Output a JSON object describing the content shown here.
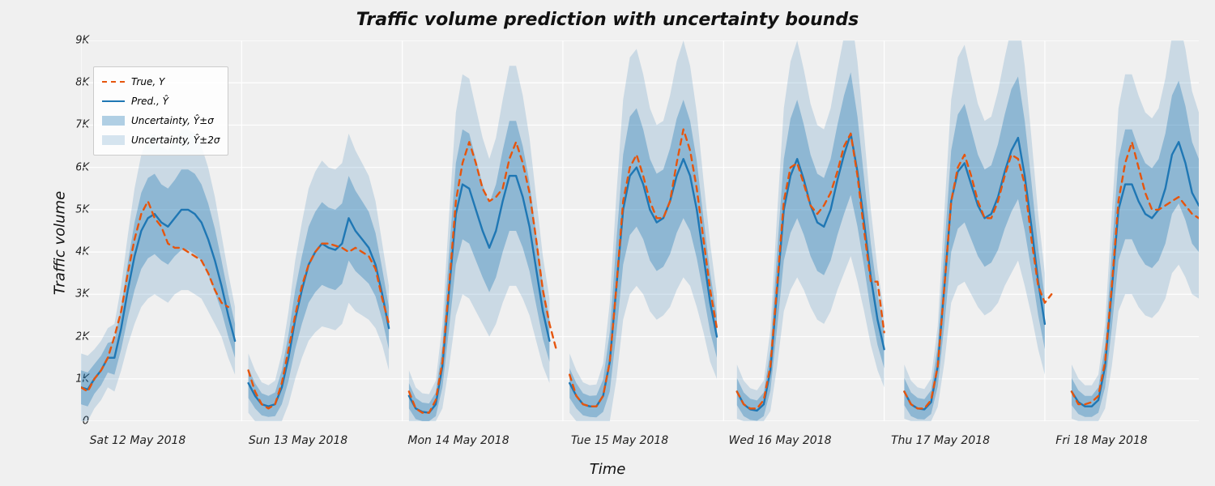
{
  "chart_data": {
    "type": "line",
    "title": "Traffic volume prediction with uncertainty bounds",
    "xlabel": "Time",
    "ylabel": "Traffic volume",
    "ylim": [
      0,
      9000
    ],
    "y_ticks": [
      0,
      1000,
      2000,
      3000,
      4000,
      5000,
      6000,
      7000,
      8000,
      9000
    ],
    "y_tick_labels": [
      "0",
      "1K",
      "2K",
      "3K",
      "4K",
      "5K",
      "6K",
      "7K",
      "8K",
      "9K"
    ],
    "x_tick_labels": [
      "Sat 12 May 2018",
      "Sun 13 May 2018",
      "Mon 14 May 2018",
      "Tue 15 May 2018",
      "Wed 16 May 2018",
      "Thu 17 May 2018",
      "Fri 18 May 2018"
    ],
    "x_tick_positions_hours": [
      0,
      24,
      48,
      72,
      96,
      120,
      144
    ],
    "legend": {
      "true": "True, Y",
      "pred": "Pred., Ŷ",
      "sigma1": "Uncertainty, Ŷ±σ",
      "sigma2": "Uncertainty, Ŷ±2σ"
    },
    "colors": {
      "true_line": "#e6550d",
      "pred_line": "#1f77b4",
      "band1": "rgba(31,119,180,0.35)",
      "band2": "rgba(31,119,180,0.18)",
      "background": "#f0f0f0",
      "grid": "#ffffff"
    },
    "series_note": "Hourly values over 7 days (168 points). 'true' and 'pred' are traffic volume; sigma is prediction std used for ±σ and ±2σ bands. Some hours have null (gaps in plotted lines).",
    "series": {
      "hour_index": [
        0,
        1,
        2,
        3,
        4,
        5,
        6,
        7,
        8,
        9,
        10,
        11,
        12,
        13,
        14,
        15,
        16,
        17,
        18,
        19,
        20,
        21,
        22,
        23,
        24,
        25,
        26,
        27,
        28,
        29,
        30,
        31,
        32,
        33,
        34,
        35,
        36,
        37,
        38,
        39,
        40,
        41,
        42,
        43,
        44,
        45,
        46,
        47,
        48,
        49,
        50,
        51,
        52,
        53,
        54,
        55,
        56,
        57,
        58,
        59,
        60,
        61,
        62,
        63,
        64,
        65,
        66,
        67,
        68,
        69,
        70,
        71,
        72,
        73,
        74,
        75,
        76,
        77,
        78,
        79,
        80,
        81,
        82,
        83,
        84,
        85,
        86,
        87,
        88,
        89,
        90,
        91,
        92,
        93,
        94,
        95,
        96,
        97,
        98,
        99,
        100,
        101,
        102,
        103,
        104,
        105,
        106,
        107,
        108,
        109,
        110,
        111,
        112,
        113,
        114,
        115,
        116,
        117,
        118,
        119,
        120,
        121,
        122,
        123,
        124,
        125,
        126,
        127,
        128,
        129,
        130,
        131,
        132,
        133,
        134,
        135,
        136,
        137,
        138,
        139,
        140,
        141,
        142,
        143,
        144,
        145,
        146,
        147,
        148,
        149,
        150,
        151,
        152,
        153,
        154,
        155,
        156,
        157,
        158,
        159,
        160,
        161,
        162,
        163,
        164,
        165,
        166,
        167
      ],
      "true": [
        800,
        700,
        1000,
        1200,
        1500,
        2000,
        2600,
        3500,
        4300,
        4900,
        5200,
        4800,
        4600,
        4200,
        4100,
        4100,
        4000,
        3900,
        3800,
        3500,
        3100,
        2800,
        2700,
        null,
        null,
        1200,
        700,
        400,
        300,
        400,
        900,
        1700,
        2500,
        3200,
        3700,
        4000,
        4200,
        4200,
        4150,
        4100,
        4000,
        4100,
        4000,
        3900,
        3600,
        2900,
        2300,
        null,
        null,
        700,
        300,
        200,
        200,
        500,
        1400,
        3200,
        5200,
        6100,
        6600,
        6100,
        5500,
        5200,
        5300,
        5500,
        6200,
        6600,
        6100,
        5400,
        4300,
        3100,
        2300,
        1700,
        null,
        1100,
        600,
        400,
        350,
        350,
        600,
        1400,
        3200,
        5200,
        6000,
        6300,
        5800,
        5200,
        4800,
        4800,
        5200,
        6100,
        6900,
        6400,
        5500,
        4300,
        3100,
        2200,
        null,
        null,
        700,
        400,
        300,
        300,
        500,
        1300,
        3200,
        5200,
        6000,
        6100,
        5600,
        5100,
        4900,
        5100,
        5400,
        5900,
        6500,
        6800,
        5800,
        4500,
        3300,
        3300,
        2100,
        null,
        null,
        700,
        400,
        300,
        300,
        500,
        1300,
        3200,
        5200,
        6000,
        6300,
        5800,
        5200,
        4800,
        4800,
        5200,
        5800,
        6300,
        6200,
        5600,
        4300,
        3200,
        2800,
        3000,
        null,
        null,
        700,
        400,
        400,
        450,
        600,
        1400,
        3200,
        5200,
        6100,
        6600,
        6000,
        5400,
        5000,
        5000,
        5100,
        5200,
        5300,
        5100,
        4900,
        4800,
        null,
        null,
        null
      ],
      "pred": [
        800,
        750,
        1000,
        1200,
        1500,
        1500,
        2200,
        3100,
        3900,
        4500,
        4800,
        4900,
        4700,
        4600,
        4800,
        5000,
        5000,
        4900,
        4700,
        4300,
        3800,
        3200,
        2500,
        1900,
        null,
        900,
        600,
        400,
        350,
        400,
        800,
        1500,
        2400,
        3100,
        3700,
        4000,
        4200,
        4100,
        4050,
        4200,
        4800,
        4500,
        4300,
        4100,
        3700,
        3000,
        2200,
        null,
        null,
        600,
        300,
        220,
        200,
        400,
        1300,
        3100,
        4900,
        5600,
        5500,
        5000,
        4500,
        4100,
        4500,
        5200,
        5800,
        5800,
        5300,
        4600,
        3600,
        2600,
        1900,
        null,
        null,
        900,
        600,
        400,
        350,
        350,
        600,
        1400,
        3200,
        5000,
        5800,
        6000,
        5600,
        5000,
        4700,
        4800,
        5200,
        5800,
        6200,
        5800,
        5000,
        3900,
        2800,
        2000,
        null,
        null,
        700,
        400,
        280,
        250,
        400,
        1200,
        3100,
        5000,
        5800,
        6200,
        5700,
        5100,
        4700,
        4600,
        5000,
        5700,
        6300,
        6800,
        5900,
        4700,
        3400,
        2400,
        1700,
        null,
        null,
        700,
        400,
        300,
        280,
        450,
        1300,
        3200,
        5200,
        5900,
        6100,
        5600,
        5100,
        4800,
        4900,
        5300,
        5900,
        6400,
        6700,
        5800,
        4600,
        3300,
        2300,
        null,
        null,
        null,
        700,
        450,
        350,
        350,
        500,
        1300,
        3100,
        5000,
        5600,
        5600,
        5200,
        4900,
        4800,
        5000,
        5500,
        6300,
        6600,
        6100,
        5400,
        5100,
        5000,
        5100,
        null
      ],
      "sigma": [
        400,
        400,
        350,
        350,
        350,
        400,
        500,
        650,
        800,
        900,
        950,
        950,
        900,
        900,
        900,
        950,
        950,
        950,
        900,
        850,
        750,
        600,
        500,
        400,
        0,
        350,
        300,
        260,
        250,
        280,
        400,
        550,
        700,
        800,
        900,
        950,
        980,
        950,
        950,
        950,
        1000,
        950,
        900,
        850,
        750,
        600,
        500,
        0,
        0,
        300,
        250,
        220,
        220,
        280,
        500,
        900,
        1200,
        1300,
        1300,
        1200,
        1100,
        1050,
        1100,
        1200,
        1300,
        1300,
        1200,
        1050,
        850,
        650,
        500,
        0,
        0,
        350,
        300,
        260,
        250,
        260,
        380,
        700,
        1100,
        1300,
        1400,
        1400,
        1300,
        1200,
        1150,
        1150,
        1250,
        1350,
        1400,
        1300,
        1150,
        900,
        700,
        500,
        0,
        0,
        320,
        280,
        250,
        240,
        280,
        480,
        900,
        1200,
        1350,
        1400,
        1300,
        1200,
        1150,
        1150,
        1200,
        1300,
        1400,
        1450,
        1300,
        1050,
        800,
        600,
        450,
        0,
        0,
        320,
        280,
        250,
        240,
        280,
        480,
        900,
        1200,
        1350,
        1400,
        1300,
        1200,
        1150,
        1150,
        1250,
        1350,
        1450,
        1450,
        1300,
        1050,
        800,
        600,
        0,
        0,
        0,
        320,
        280,
        250,
        250,
        300,
        500,
        900,
        1200,
        1300,
        1300,
        1250,
        1200,
        1180,
        1200,
        1300,
        1400,
        1450,
        1350,
        1200,
        1100,
        1100,
        1100,
        0
      ]
    }
  }
}
